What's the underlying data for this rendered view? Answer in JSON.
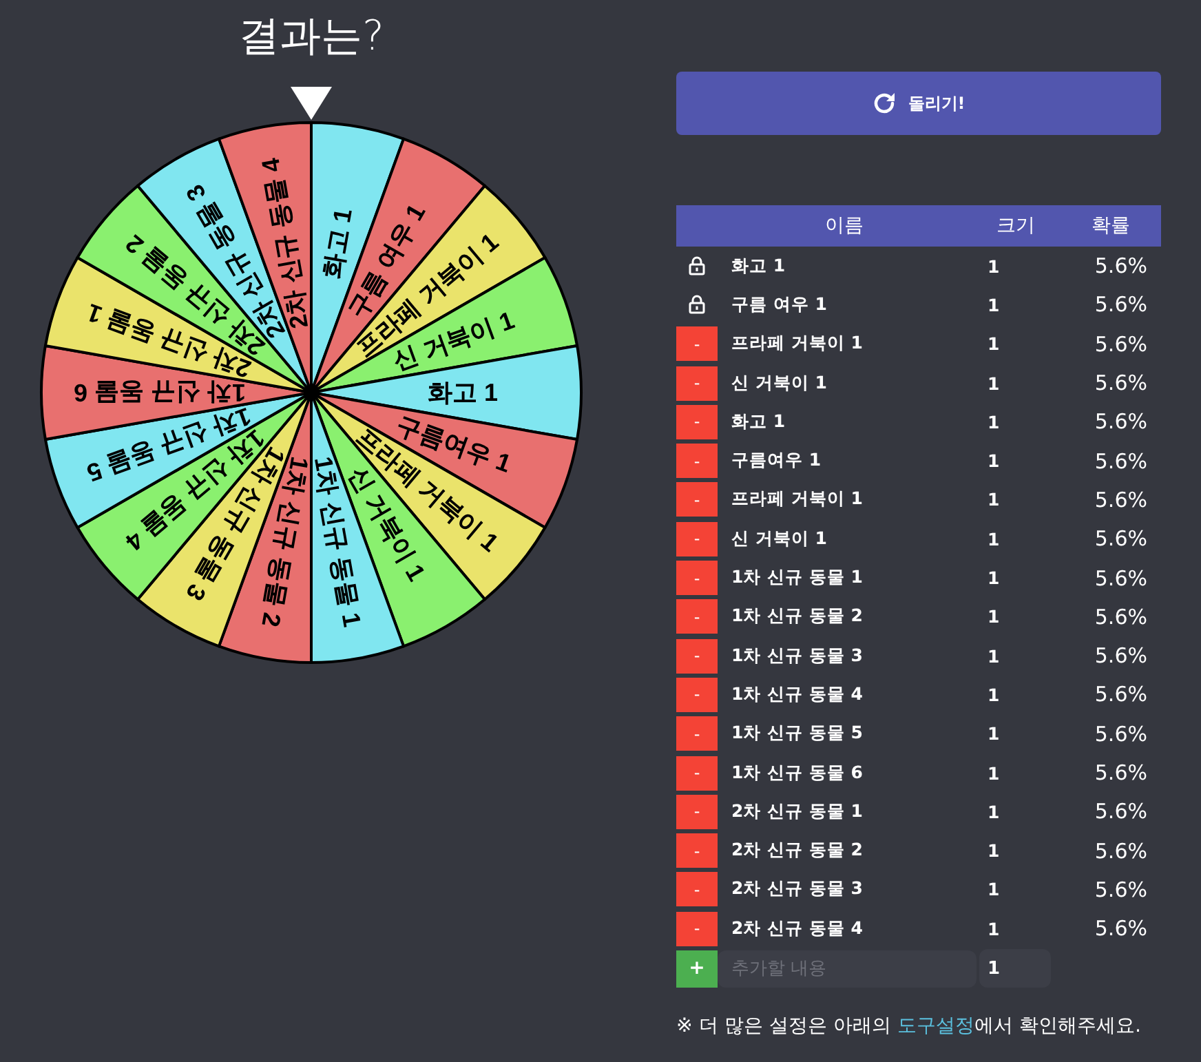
{
  "title": "결과는?",
  "wheel": {
    "segments": [
      {
        "label": "화고 1",
        "color": "#80e6f0"
      },
      {
        "label": "구름 여우 1",
        "color": "#e8706f"
      },
      {
        "label": "프라페 거북이 1",
        "color": "#eae36b"
      },
      {
        "label": "신 거북이 1",
        "color": "#8af06f"
      },
      {
        "label": "화고 1",
        "color": "#80e6f0"
      },
      {
        "label": "구름여우 1",
        "color": "#e8706f"
      },
      {
        "label": "프라페 거북이 1",
        "color": "#eae36b"
      },
      {
        "label": "신 거북이 1",
        "color": "#8af06f"
      },
      {
        "label": "1차 신규 동물 1",
        "color": "#80e6f0"
      },
      {
        "label": "1차 신규 동물 2",
        "color": "#e8706f"
      },
      {
        "label": "1차 신규 동물 3",
        "color": "#eae36b"
      },
      {
        "label": "1차 신규 동물 4",
        "color": "#8af06f"
      },
      {
        "label": "1차 신규 동물 5",
        "color": "#80e6f0"
      },
      {
        "label": "1차 신규 동물 6",
        "color": "#e8706f"
      },
      {
        "label": "2차 신규 동물 1",
        "color": "#eae36b"
      },
      {
        "label": "2차 신규 동물 2",
        "color": "#8af06f"
      },
      {
        "label": "2차 신규 동물 3",
        "color": "#80e6f0"
      },
      {
        "label": "2차 신규 동물 4",
        "color": "#e8706f"
      }
    ]
  },
  "spin_button": {
    "label": "돌리기!"
  },
  "table": {
    "columns": [
      "이름",
      "크기",
      "확률"
    ],
    "rows": [
      {
        "kind": "locked",
        "name": "화고 1",
        "size": "1",
        "probability": "5.6%"
      },
      {
        "kind": "locked",
        "name": "구름 여우 1",
        "size": "1",
        "probability": "5.6%"
      },
      {
        "kind": "removable",
        "button": "-",
        "name": "프라페 거북이 1",
        "size": "1",
        "probability": "5.6%"
      },
      {
        "kind": "removable",
        "button": "-",
        "name": "신 거북이 1",
        "size": "1",
        "probability": "5.6%"
      },
      {
        "kind": "removable",
        "button": "-",
        "name": "화고 1",
        "size": "1",
        "probability": "5.6%"
      },
      {
        "kind": "removable",
        "button": "-",
        "name": "구름여우 1",
        "size": "1",
        "probability": "5.6%"
      },
      {
        "kind": "removable",
        "button": "-",
        "name": "프라페 거북이 1",
        "size": "1",
        "probability": "5.6%"
      },
      {
        "kind": "removable",
        "button": "-",
        "name": "신 거북이 1",
        "size": "1",
        "probability": "5.6%"
      },
      {
        "kind": "removable",
        "button": "-",
        "name": "1차 신규 동물 1",
        "size": "1",
        "probability": "5.6%"
      },
      {
        "kind": "removable",
        "button": "-",
        "name": "1차 신규 동물 2",
        "size": "1",
        "probability": "5.6%"
      },
      {
        "kind": "removable",
        "button": "-",
        "name": "1차 신규 동물 3",
        "size": "1",
        "probability": "5.6%"
      },
      {
        "kind": "removable",
        "button": "-",
        "name": "1차 신규 동물 4",
        "size": "1",
        "probability": "5.6%"
      },
      {
        "kind": "removable",
        "button": "-",
        "name": "1차 신규 동물 5",
        "size": "1",
        "probability": "5.6%"
      },
      {
        "kind": "removable",
        "button": "-",
        "name": "1차 신규 동물 6",
        "size": "1",
        "probability": "5.6%"
      },
      {
        "kind": "removable",
        "button": "-",
        "name": "2차 신규 동물 1",
        "size": "1",
        "probability": "5.6%"
      },
      {
        "kind": "removable",
        "button": "-",
        "name": "2차 신규 동물 2",
        "size": "1",
        "probability": "5.6%"
      },
      {
        "kind": "removable",
        "button": "-",
        "name": "2차 신규 동물 3",
        "size": "1",
        "probability": "5.6%"
      },
      {
        "kind": "removable",
        "button": "-",
        "name": "2차 신규 동물 4",
        "size": "1",
        "probability": "5.6%"
      }
    ],
    "add_row": {
      "button": "+",
      "placeholder": "추가할 내용",
      "size": "1"
    }
  },
  "note": {
    "text_before": "※ 더 많은 설정은 아래의 ",
    "link": "도구설정",
    "text_after": "에서 확인해주세요."
  }
}
